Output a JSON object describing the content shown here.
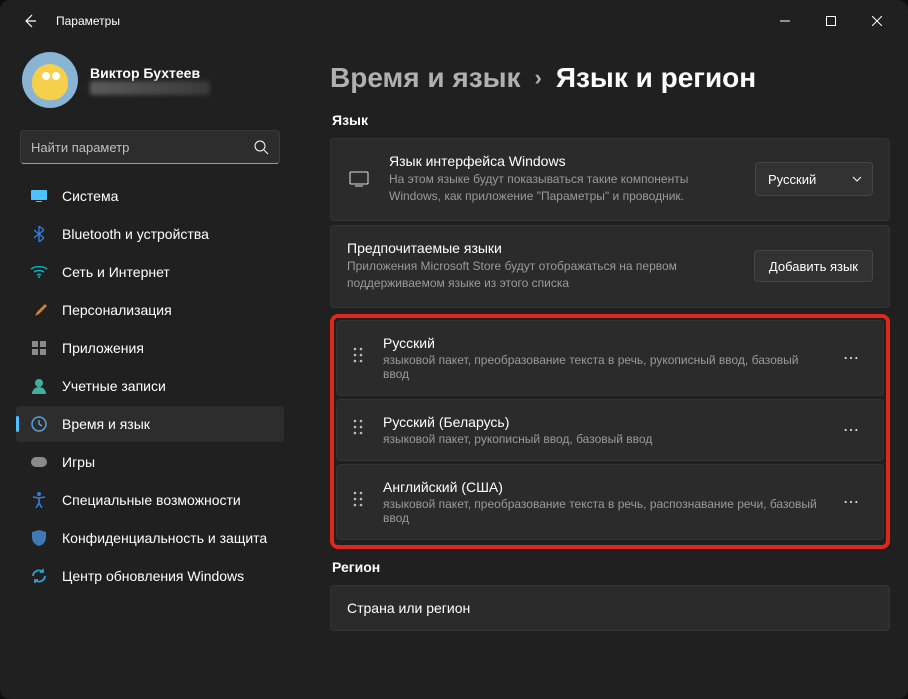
{
  "window": {
    "title": "Параметры"
  },
  "profile": {
    "name": "Виктор Бухтеев"
  },
  "search": {
    "placeholder": "Найти параметр"
  },
  "sidebar": {
    "items": [
      {
        "label": "Система",
        "icon": "display-icon",
        "color": "#4cc2ff"
      },
      {
        "label": "Bluetooth и устройства",
        "icon": "bluetooth-icon",
        "color": "#2f7fe0"
      },
      {
        "label": "Сеть и Интернет",
        "icon": "wifi-icon",
        "color": "#00b7c3"
      },
      {
        "label": "Персонализация",
        "icon": "brush-icon",
        "color": "#d08030"
      },
      {
        "label": "Приложения",
        "icon": "apps-icon",
        "color": "#8a8a8a"
      },
      {
        "label": "Учетные записи",
        "icon": "person-icon",
        "color": "#3fb0a0"
      },
      {
        "label": "Время и язык",
        "icon": "clock-globe-icon",
        "color": "#5aa0d8",
        "active": true
      },
      {
        "label": "Игры",
        "icon": "gamepad-icon",
        "color": "#8a8a8a"
      },
      {
        "label": "Специальные возможности",
        "icon": "accessibility-icon",
        "color": "#2f7fe0"
      },
      {
        "label": "Конфиденциальность и защита",
        "icon": "shield-icon",
        "color": "#3f78b5"
      },
      {
        "label": "Центр обновления Windows",
        "icon": "update-icon",
        "color": "#2f9fd8"
      }
    ]
  },
  "breadcrumb": {
    "parent": "Время и язык",
    "current": "Язык и регион"
  },
  "sections": {
    "language_header": "Язык",
    "region_header": "Регион"
  },
  "display_language": {
    "title": "Язык интерфейса Windows",
    "subtitle": "На этом языке будут показываться такие компоненты Windows, как приложение \"Параметры\" и проводник.",
    "selected": "Русский"
  },
  "preferred": {
    "title": "Предпочитаемые языки",
    "subtitle": "Приложения Microsoft Store будут отображаться на первом поддерживаемом языке из этого списка",
    "add_button": "Добавить язык"
  },
  "languages": [
    {
      "name": "Русский",
      "subtitle": "языковой пакет, преобразование текста в речь, рукописный ввод, базовый ввод"
    },
    {
      "name": "Русский (Беларусь)",
      "subtitle": "языковой пакет, рукописный ввод, базовый ввод"
    },
    {
      "name": "Английский (США)",
      "subtitle": "языковой пакет, преобразование текста в речь, распознавание речи, базовый ввод"
    }
  ],
  "region": {
    "title": "Страна или регион"
  }
}
